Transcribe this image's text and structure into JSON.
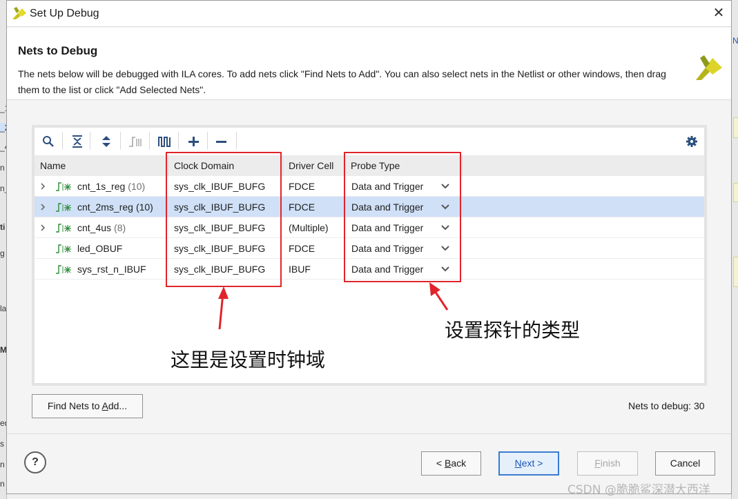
{
  "dialog": {
    "title": "Set Up Debug",
    "close_glyph": "✕",
    "logo_icon": "xilinx-logo-icon"
  },
  "header": {
    "title": "Nets to Debug",
    "description": "The nets below will be debugged with ILA cores. To add nets click \"Find Nets to Add\". You can also select nets in the Netlist or other windows, then drag them to the list or click \"Add Selected Nets\"."
  },
  "toolbar": {
    "icons": [
      "search-icon",
      "collapse-all-icon",
      "expand-all-icon",
      "net-type-icon",
      "waveform-icon",
      "add-icon",
      "remove-icon",
      "gear-icon"
    ]
  },
  "table": {
    "columns": [
      "Name",
      "Clock Domain",
      "Driver Cell",
      "Probe Type"
    ],
    "rows": [
      {
        "name": "cnt_1s_reg",
        "width": "(10)",
        "clock": "sys_clk_IBUF_BUFG",
        "driver": "FDCE",
        "probe": "Data and Trigger",
        "expandable": true,
        "selected": false
      },
      {
        "name": "cnt_2ms_reg",
        "width": "(10)",
        "clock": "sys_clk_IBUF_BUFG",
        "driver": "FDCE",
        "probe": "Data and Trigger",
        "expandable": true,
        "selected": true
      },
      {
        "name": "cnt_4us",
        "width": "(8)",
        "clock": "sys_clk_IBUF_BUFG",
        "driver": "(Multiple)",
        "probe": "Data and Trigger",
        "expandable": true,
        "selected": false
      },
      {
        "name": "led_OBUF",
        "width": "",
        "clock": "sys_clk_IBUF_BUFG",
        "driver": "FDCE",
        "probe": "Data and Trigger",
        "expandable": false,
        "selected": false
      },
      {
        "name": "sys_rst_n_IBUF",
        "width": "",
        "clock": "sys_clk_IBUF_BUFG",
        "driver": "IBUF",
        "probe": "Data and Trigger",
        "expandable": false,
        "selected": false
      }
    ]
  },
  "annotations": {
    "clock_note": "这里是设置时钟域",
    "probe_note": "设置探针的类型",
    "highlight_color": "#e0242b"
  },
  "find_nets": {
    "label_pre": "Find Nets to ",
    "label_u": "A",
    "label_post": "dd..."
  },
  "nets_count": "Nets to debug: 30",
  "footer": {
    "help": "?",
    "back_pre": "< ",
    "back_u": "B",
    "back_post": "ack",
    "next_u": "N",
    "next_post": "ext >",
    "finish_u": "F",
    "finish_post": "inish",
    "cancel": "Cancel"
  },
  "watermark": "CSDN @脆脆鲨深潜大西洋",
  "background": {
    "left_fragments": [
      "_1",
      "_2",
      "_4",
      "n",
      "n_",
      "ti",
      "g",
      "la",
      "M",
      "ed",
      "s",
      "n",
      "n"
    ],
    "right_fragments": [
      "N"
    ]
  }
}
